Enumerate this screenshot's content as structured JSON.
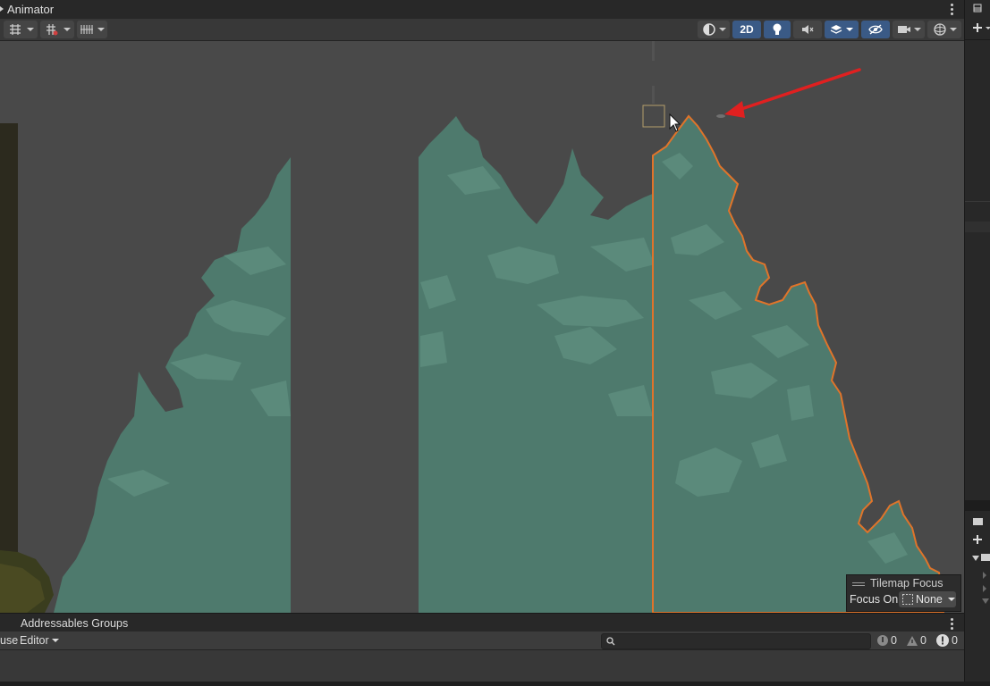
{
  "window": {
    "title": "Animator"
  },
  "toolbar": {
    "view_2d_label": "2D",
    "icons": [
      "grid-snap-icon",
      "grid-increment-icon",
      "gizmo-toggle-icon",
      "shading-mode-icon",
      "light-bulb-icon",
      "audio-mute-icon",
      "effects-layers-icon",
      "hidden-visibility-icon",
      "camera-icon",
      "gizmos-sphere-icon"
    ]
  },
  "scene": {
    "background_color": "#494949",
    "tree_color": "#4e7a6d",
    "tree_highlight_color": "#5b8a7b",
    "selection_outline_color": "#e0742a",
    "annotation_arrow_color": "#e02020"
  },
  "tilemap_focus": {
    "title": "Tilemap Focus",
    "focus_on_label": "Focus On",
    "selected_value": "None"
  },
  "bottom_panel": {
    "tab_title": "Addressables Groups",
    "left_partial_label": "use",
    "editor_dropdown": "Editor",
    "search_placeholder": "",
    "counters": {
      "messages": "0",
      "warnings": "0",
      "errors": "0"
    }
  }
}
